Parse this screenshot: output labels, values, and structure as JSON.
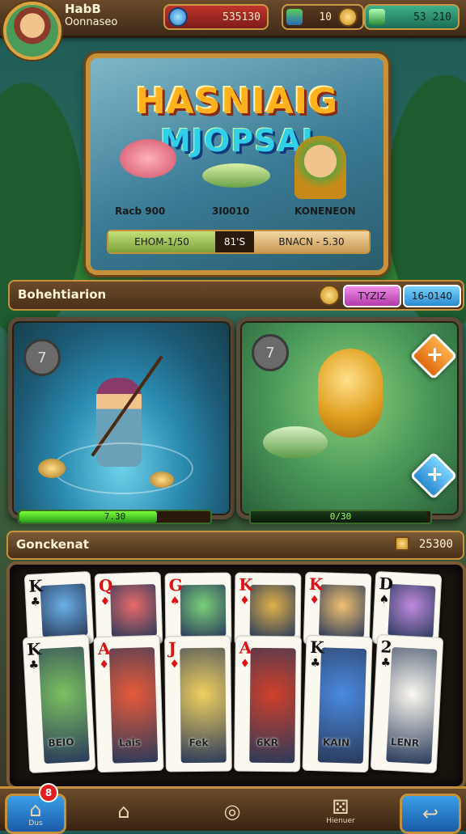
{
  "player": {
    "name": "HabB",
    "subtitle": "Oonnaseo"
  },
  "resources": [
    {
      "icon": "gem-icon",
      "value": "535130"
    },
    {
      "icon": "gold-coin-icon",
      "value": "10"
    },
    {
      "icon": "shield-gem-icon",
      "value": "53 210"
    }
  ],
  "banner": {
    "title_line1": "HASNIAIG",
    "title_line2": "MJOPSAI",
    "labels": [
      "Racb 900",
      "3I0010",
      "KONENEON"
    ],
    "stats": [
      "EHOM-1/50",
      "81'S",
      "BNACN - 5.30"
    ]
  },
  "section1": {
    "title": "Bohehtiarion",
    "pill1": "TYZIZ",
    "pill2": "16-0140"
  },
  "panels": [
    {
      "badge": "7",
      "progress_label": "7.30",
      "progress": 0.72
    },
    {
      "badge": "7",
      "progress_label": "0/30",
      "progress": 0.98,
      "plus_label": "+",
      "blue_label": "+"
    }
  ],
  "section2": {
    "title": "Gonckenat",
    "value": "25300"
  },
  "cards": [
    {
      "rank": "K",
      "suit": "♣",
      "color": "blk",
      "name": ""
    },
    {
      "rank": "Q",
      "suit": "♦",
      "color": "red",
      "name": ""
    },
    {
      "rank": "G",
      "suit": "♠",
      "color": "red",
      "name": ""
    },
    {
      "rank": "K",
      "suit": "♦",
      "color": "red",
      "name": ""
    },
    {
      "rank": "K",
      "suit": "♦",
      "color": "red",
      "name": ""
    },
    {
      "rank": "D",
      "suit": "♠",
      "color": "blk",
      "name": ""
    },
    {
      "rank": "K",
      "suit": "♣",
      "color": "blk",
      "name": "BEIO"
    },
    {
      "rank": "A",
      "suit": "♦",
      "color": "red",
      "name": "Lais"
    },
    {
      "rank": "J",
      "suit": "♦",
      "color": "red",
      "name": "Fek"
    },
    {
      "rank": "A",
      "suit": "♦",
      "color": "red",
      "name": "6KR"
    },
    {
      "rank": "K",
      "suit": "♣",
      "color": "blk",
      "name": "KAIN"
    },
    {
      "rank": "2",
      "suit": "♣",
      "color": "blk",
      "name": "LENR"
    }
  ],
  "nav": [
    {
      "icon": "home-icon",
      "label": "Dus"
    },
    {
      "icon": "house-icon",
      "label": ""
    },
    {
      "icon": "ring-icon",
      "label": ""
    },
    {
      "icon": "dice-icon",
      "label": "Hienuer"
    },
    {
      "icon": "back-arrow-icon",
      "label": ""
    }
  ],
  "notification_count": "8"
}
